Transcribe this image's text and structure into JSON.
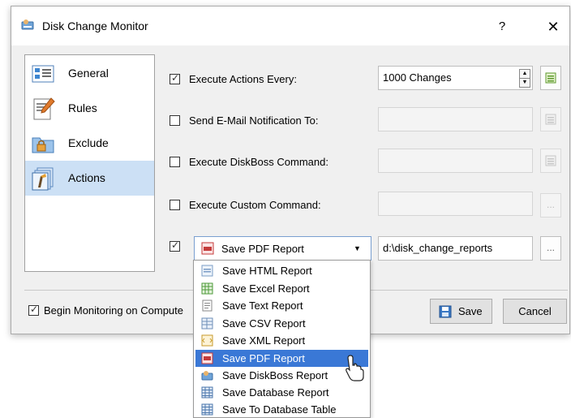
{
  "window": {
    "title": "Disk Change Monitor",
    "help": "?",
    "close": "✕"
  },
  "sidebar": {
    "items": [
      {
        "label": "General",
        "icon": "general-icon",
        "active": false
      },
      {
        "label": "Rules",
        "icon": "rules-icon",
        "active": false
      },
      {
        "label": "Exclude",
        "icon": "exclude-icon",
        "active": false
      },
      {
        "label": "Actions",
        "icon": "actions-icon",
        "active": true
      }
    ]
  },
  "actions": {
    "execute_every": {
      "label": "Execute Actions Every:",
      "checked": true,
      "value": "1000 Changes"
    },
    "email": {
      "label": "Send E-Mail Notification To:",
      "checked": false,
      "value": ""
    },
    "diskboss": {
      "label": "Execute DiskBoss Command:",
      "checked": false,
      "value": ""
    },
    "custom": {
      "label": "Execute Custom Command:",
      "checked": false,
      "value": "",
      "browse": "..."
    },
    "report": {
      "checked": true,
      "selected": "Save PDF Report",
      "path": "d:\\disk_change_reports",
      "browse": "..."
    }
  },
  "dropdown": {
    "options": [
      {
        "label": "Save HTML Report",
        "icon": "html-report-icon"
      },
      {
        "label": "Save Excel Report",
        "icon": "excel-report-icon"
      },
      {
        "label": "Save Text Report",
        "icon": "text-report-icon"
      },
      {
        "label": "Save CSV Report",
        "icon": "csv-report-icon"
      },
      {
        "label": "Save XML Report",
        "icon": "xml-report-icon"
      },
      {
        "label": "Save PDF Report",
        "icon": "pdf-report-icon",
        "selected": true
      },
      {
        "label": "Save DiskBoss Report",
        "icon": "diskboss-report-icon"
      },
      {
        "label": "Save Database Report",
        "icon": "database-report-icon"
      },
      {
        "label": "Save To Database Table",
        "icon": "database-table-icon"
      }
    ]
  },
  "footer": {
    "begin_monitoring_label": "Begin Monitoring on Compute",
    "begin_monitoring_checked": true,
    "save_label": "Save",
    "cancel_label": "Cancel"
  },
  "colors": {
    "accent": "#3a78d6",
    "sidebar_active": "#cce0f5",
    "dialog_bg": "#f0f0f0"
  }
}
